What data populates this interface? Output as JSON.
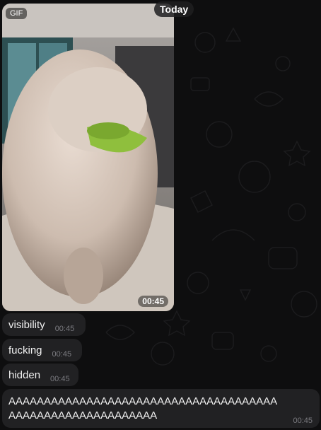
{
  "chat": {
    "date_label": "Today",
    "gif_message": {
      "badge": "GIF",
      "time": "00:45"
    },
    "messages": [
      {
        "text": "visibility",
        "time": "00:45"
      },
      {
        "text": "fucking",
        "time": "00:45"
      },
      {
        "text": "hidden",
        "time": "00:45"
      }
    ],
    "long_message": {
      "line1": "AAAAAAAAAAAAAAAAAAAAAAAAAAAAAAAAAAAAAA",
      "line2": "AAAAAAAAAAAAAAAAAAAAA",
      "time": "00:45"
    }
  },
  "colors": {
    "background": "#0e0e0f",
    "bubble": "#212123",
    "timestamp": "#7b7b80"
  }
}
